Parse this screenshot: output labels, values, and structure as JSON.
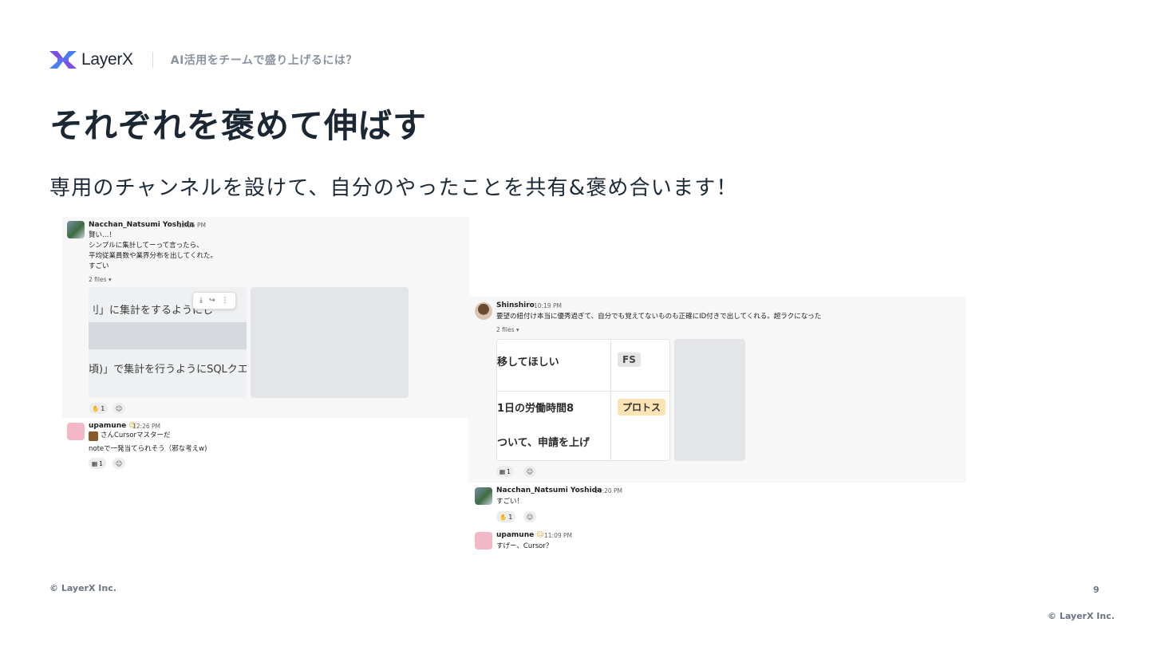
{
  "header": {
    "brand": "LayerX",
    "subtitle": "AI活用をチームで盛り上げるには？"
  },
  "slide": {
    "title": "それぞれを褒めて伸ばす",
    "lead": "専用のチャンネルを設けて、自分のやったことを共有&褒め合います！",
    "page_number": "9"
  },
  "footer": {
    "copyright_left": "© LayerX Inc.",
    "copyright_right": "© LayerX Inc."
  },
  "colors": {
    "title": "#1b2733",
    "logo_blue": "#4a7df0",
    "logo_purple": "#7b4fe0",
    "muted": "#8a939e",
    "avatar_pink": "#f2b8c8"
  },
  "shot_left": {
    "post1": {
      "user": "Nacchan_Natsumi Yoshida",
      "time": "12:25 PM",
      "lines": [
        "賢い…！",
        "シンプルに集計してーって言ったら、",
        "平均従業員数や業界分布を出してくれた。",
        "すごい"
      ],
      "files": "2 files",
      "thumb_lines": [
        "刂」に集計をするようにし",
        "頃)」で集計を行うようにSQLクエリ"
      ],
      "reaction_count": "1"
    },
    "post2": {
      "user": "upamune",
      "time": "12:26 PM",
      "lines": [
        "さんCursorマスターだ",
        "noteで一発当てられそう（邪な考えw)"
      ],
      "reaction_count": "1"
    }
  },
  "shot_right": {
    "post1": {
      "user": "Shinshiro",
      "time": "10:19 PM",
      "text": "要望の紐付け本当に優秀過ぎて、自分でも覚えてないものも正確にID付きで出してくれる。超ラクになった",
      "files": "2 files",
      "table_rows": [
        "移してほしい",
        "1日の労働時間8",
        "ついて、申請を上げ"
      ],
      "tags": [
        "FS",
        "プロトス"
      ],
      "reaction_count": "1"
    },
    "post2": {
      "user": "Nacchan_Natsumi Yoshida",
      "time": "10:20 PM",
      "text": "すごい！",
      "reaction_count": "1"
    },
    "post3": {
      "user": "upamune",
      "time": "11:09 PM",
      "text": "すげー、Cursor？"
    }
  }
}
